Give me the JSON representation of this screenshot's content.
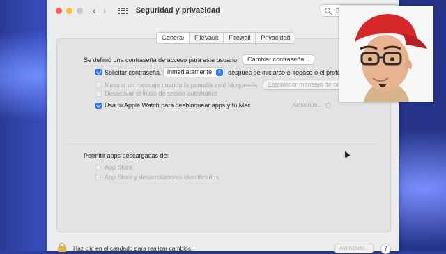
{
  "window": {
    "title": "Seguridad y privacidad",
    "search_placeholder": "Buscar"
  },
  "tabs": [
    "General",
    "FileVault",
    "Firewall",
    "Privacidad"
  ],
  "general": {
    "password_set_text": "Se definió una contraseña de acceso para este usuario",
    "change_password_button": "Cambiar contraseña...",
    "require_password_label": "Solicitar contraseña",
    "require_password_value": "inmediatamente",
    "require_password_suffix": "después de iniciarse el reposo o el protector",
    "show_message_label": "Mostrar un mensaje cuando la pantalla esté bloqueada",
    "set_message_button": "Establecer mensaje de bloqueo",
    "disable_autologin_label": "Desactivar el inicio de sesión automático",
    "apple_watch_label": "Usa tu Apple Watch para desbloquear apps y tu Mac",
    "activating_status": "Activando..."
  },
  "downloads": {
    "heading": "Permitir apps descargadas de:",
    "options": [
      "App Store",
      "App Store y desarrolladores identificados"
    ]
  },
  "footer": {
    "lock_text": "Haz clic en el candado para realizar cambios.",
    "advanced_button": "Avanzado...",
    "help_label": "?"
  },
  "colors": {
    "accent": "#2c7bf0",
    "close": "#fe5f57",
    "minimize": "#febc2e"
  }
}
